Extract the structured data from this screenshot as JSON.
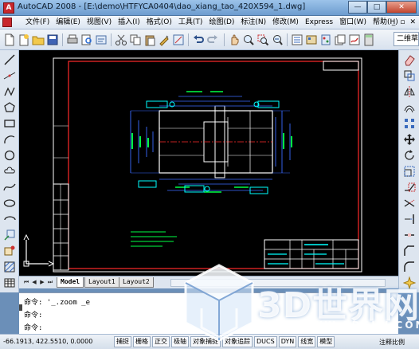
{
  "window": {
    "title": "AutoCAD 2008 - [E:\\demo\\HTFYCA0404\\dao_xiang_tao_420X594_1.dwg]",
    "app_icon_letter": "A",
    "minimize": "—",
    "maximize": "□",
    "close": "✕"
  },
  "menubar": {
    "items": [
      "文件(F)",
      "编辑(E)",
      "视图(V)",
      "插入(I)",
      "格式(O)",
      "工具(T)",
      "绘图(D)",
      "标注(N)",
      "修改(M)",
      "Express",
      "窗口(W)",
      "帮助(H)"
    ],
    "controls": [
      "_",
      "▫",
      "✕"
    ]
  },
  "toolbar": {
    "workspace_value": "二维草"
  },
  "layout_tabs": {
    "tabs": [
      "Model",
      "Layout1",
      "Layout2"
    ],
    "active": "Model"
  },
  "command_line": {
    "lines": [
      "命令: '_.zoom _e",
      "命令:",
      "命令:"
    ]
  },
  "statusbar": {
    "coordinates": "-66.1913, 422.5510, 0.0000",
    "buttons": [
      "捕捉",
      "栅格",
      "正交",
      "极轴",
      "对象捕捉",
      "对象追踪",
      "DUCS",
      "DYN",
      "线宽",
      "模型"
    ],
    "annotation_scale": "注释比例"
  },
  "watermark": {
    "brand": "3D世界网",
    "url": "WWW.3DSJW.COM"
  },
  "colors": {
    "canvas": "#000000",
    "frame": "#ffffff",
    "border_red": "#ff0000",
    "dim_cyan": "#00ffff",
    "dim_blue": "#3a6bff",
    "dim_green": "#00ff00"
  }
}
